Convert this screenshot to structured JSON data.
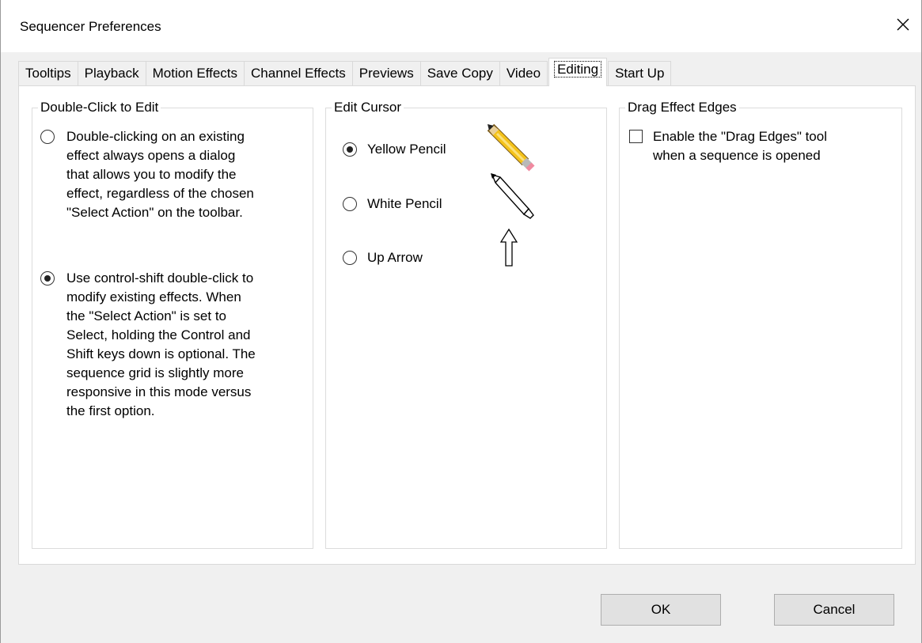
{
  "window": {
    "title": "Sequencer Preferences",
    "close_icon": "close-icon"
  },
  "tabs": [
    {
      "label": "Tooltips",
      "active": false
    },
    {
      "label": "Playback",
      "active": false
    },
    {
      "label": "Motion Effects",
      "active": false
    },
    {
      "label": "Channel Effects",
      "active": false
    },
    {
      "label": "Previews",
      "active": false
    },
    {
      "label": "Save Copy",
      "active": false
    },
    {
      "label": "Video",
      "active": false
    },
    {
      "label": "Editing",
      "active": true
    },
    {
      "label": "Start Up",
      "active": false
    }
  ],
  "double_click": {
    "legend": "Double-Click to Edit",
    "options": [
      {
        "lines": [
          "Double-clicking on an existing",
          "effect always opens a dialog",
          "that allows you to modify the",
          "effect, regardless of the chosen",
          "\"Select Action\" on the toolbar."
        ],
        "checked": false
      },
      {
        "lines": [
          "Use control-shift double-click to",
          "modify existing effects. When",
          "the \"Select Action\" is set to",
          "Select, holding the Control and",
          "Shift keys down is optional. The",
          "sequence grid is slightly more",
          "responsive in this mode versus",
          "the first option."
        ],
        "checked": true
      }
    ]
  },
  "edit_cursor": {
    "legend": "Edit Cursor",
    "options": [
      {
        "label": "Yellow Pencil",
        "checked": true,
        "icon": "yellow-pencil-icon"
      },
      {
        "label": "White Pencil",
        "checked": false,
        "icon": "white-pencil-icon"
      },
      {
        "label": "Up Arrow",
        "checked": false,
        "icon": "up-arrow-icon"
      }
    ]
  },
  "drag_edges": {
    "legend": "Drag Effect Edges",
    "checkbox": {
      "lines": [
        "Enable the \"Drag Edges\" tool",
        "when a sequence is opened"
      ],
      "checked": false
    }
  },
  "buttons": {
    "ok": "OK",
    "cancel": "Cancel"
  }
}
